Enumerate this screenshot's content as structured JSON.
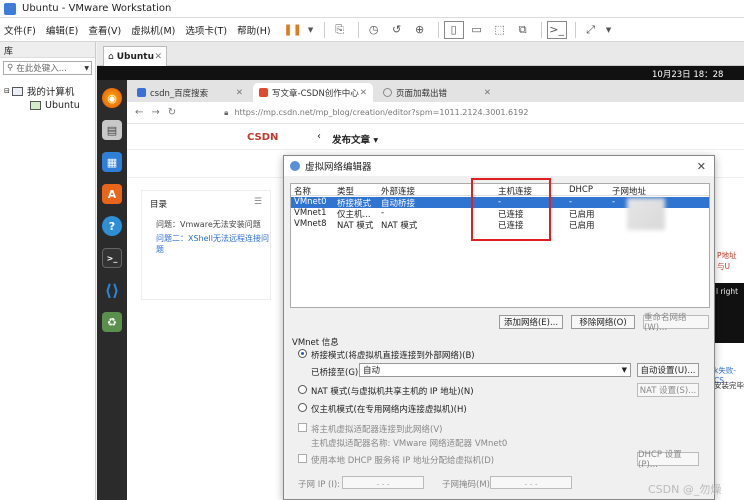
{
  "window": {
    "title": "Ubuntu - VMware Workstation"
  },
  "menu": [
    "文件(F)",
    "编辑(E)",
    "查看(V)",
    "虚拟机(M)",
    "选项卡(T)",
    "帮助(H)"
  ],
  "library": {
    "header": "库",
    "search_placeholder": "在此处键入...",
    "tree": {
      "root": "我的计算机",
      "child": "Ubuntu"
    }
  },
  "vm_tab": {
    "label": "Ubuntu"
  },
  "guest": {
    "clock": "10月23日 18：28"
  },
  "browser": {
    "tabs": [
      "csdn_百度搜索",
      "写文章-CSDN创作中心",
      "页面加载出错"
    ],
    "url": "https://mp.csdn.net/mp_blog/creation/editor?spm=1011.2124.3001.6192",
    "logo": "CSDN",
    "publish_title": "发布文章",
    "toc": {
      "header": "目录",
      "items": [
        "问题：Vmware无法安装问题",
        "问题二：XShell无法远程连接问题"
      ]
    },
    "right_snippets": {
      "red": "P地址与U",
      "term": "l right",
      "blue": "k失败-CS",
      "dark": "安装完毕"
    }
  },
  "dialog": {
    "title": "虚拟网络编辑器",
    "columns": [
      "名称",
      "类型",
      "外部连接",
      "主机连接",
      "DHCP",
      "子网地址"
    ],
    "rows": [
      [
        "VMnet0",
        "桥接模式",
        "自动桥接",
        "-",
        "-",
        "-"
      ],
      [
        "VMnet1",
        "仅主机...",
        "-",
        "已连接",
        "已启用",
        ""
      ],
      [
        "VMnet8",
        "NAT 模式",
        "NAT 模式",
        "已连接",
        "已启用",
        ""
      ]
    ],
    "buttons": {
      "add": "添加网络(E)...",
      "remove": "移除网络(O)",
      "rename": "重命名网络(W)..."
    },
    "info_title": "VMnet 信息",
    "bridge_radio": "桥接模式(将虚拟机直接连接到外部网络)(B)",
    "bridged_to_label": "已桥接至(G):",
    "bridged_to_value": "自动",
    "auto_settings": "自动设置(U)...",
    "nat_radio": "NAT 模式(与虚拟机共享主机的 IP 地址)(N)",
    "nat_settings": "NAT 设置(S)...",
    "hostonly_radio": "仅主机模式(在专用网络内连接虚拟机)(H)",
    "host_adapter_check": "将主机虚拟适配器连接到此网络(V)",
    "host_adapter_name": "主机虚拟适配器名称: VMware 网络适配器 VMnet0",
    "dhcp_check": "使用本地 DHCP 服务将 IP 地址分配给虚拟机(D)",
    "dhcp_settings": "DHCP 设置(P)...",
    "subnet_ip_label": "子网 IP (I):",
    "subnet_mask_label": "子网掩码(M):",
    "ip_placeholder": ".   .   ."
  },
  "watermark": "CSDN @_勿燥"
}
